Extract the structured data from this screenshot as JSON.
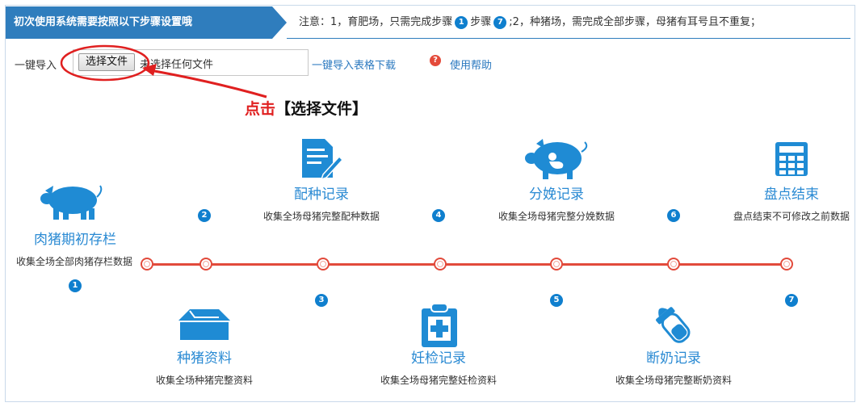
{
  "header": {
    "title": "初次使用系统需要按照以下步骤设置哦",
    "notice_prefix": "注意：1，育肥场，只需完成步骤",
    "notice_step_a": "1",
    "notice_mid": "步骤",
    "notice_step_b": "7",
    "notice_suffix": ";2，种猪场，需完成全部步骤，母猪有耳号且不重复；"
  },
  "import_bar": {
    "label": "一键导入",
    "choose_button": "选择文件",
    "file_status": "未选择任何文件",
    "template_link": "一键导入表格下载",
    "help_icon_glyph": "?",
    "help_link": "使用帮助"
  },
  "annotation": {
    "action_word": "点击",
    "target": "【选择文件】",
    "color": "#e02020"
  },
  "steps": [
    {
      "num": "1",
      "title": "肉猪期初存栏",
      "desc": "收集全场全部肉猪存栏数据",
      "icon": "pig-icon"
    },
    {
      "num": "2",
      "title": "种猪资料",
      "desc": "收集全场种猪完整资料",
      "icon": "barn-icon"
    },
    {
      "num": "3",
      "title": "配种记录",
      "desc": "收集全场母猪完整配种数据",
      "icon": "document-edit-icon"
    },
    {
      "num": "4",
      "title": "妊检记录",
      "desc": "收集全场母猪完整妊检资料",
      "icon": "medical-clipboard-icon"
    },
    {
      "num": "5",
      "title": "分娩记录",
      "desc": "收集全场母猪完整分娩数据",
      "icon": "pig-birth-icon"
    },
    {
      "num": "6",
      "title": "断奶记录",
      "desc": "收集全场母猪完整断奶资料",
      "icon": "baby-bottle-icon"
    },
    {
      "num": "7",
      "title": "盘点结束",
      "desc": "盘点结束不可修改之前数据",
      "icon": "calculator-icon"
    }
  ],
  "colors": {
    "accent": "#2f7dbd",
    "timeline": "#e24a3b",
    "badge": "#0f7fce",
    "title": "#2a8ad3"
  }
}
